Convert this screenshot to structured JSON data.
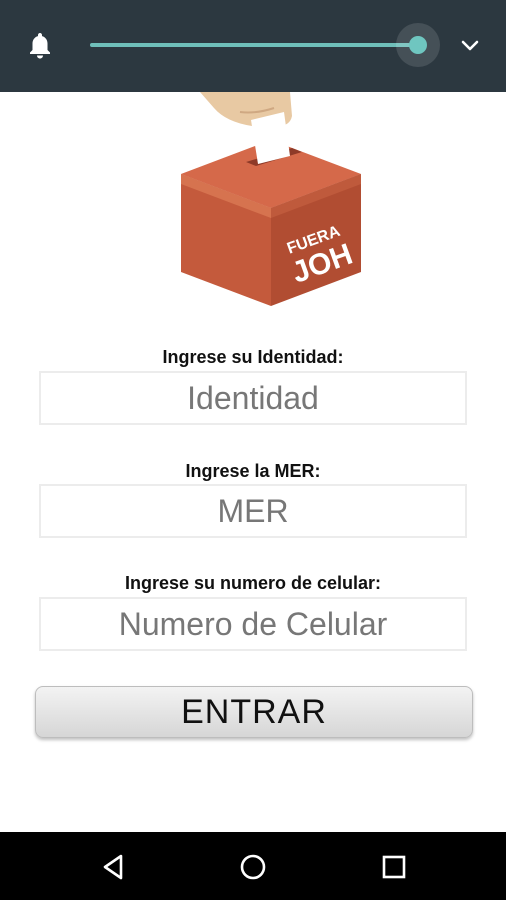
{
  "volume_panel": {
    "icon": "bell-icon",
    "level": 1.0,
    "expand_icon": "chevron-down-icon",
    "accent_color": "#6fc6c0"
  },
  "logo": {
    "box_text_line1": "FUERA",
    "box_text_line2": "JOH"
  },
  "form": {
    "identity_label": "Ingrese su Identidad:",
    "identity_placeholder": "Identidad",
    "mer_label": "Ingrese la MER:",
    "mer_placeholder": "MER",
    "phone_label": "Ingrese su numero de celular:",
    "phone_placeholder": "Numero de Celular",
    "submit_label": "ENTRAR"
  },
  "navbar": {
    "back_icon": "back-triangle-icon",
    "home_icon": "home-circle-icon",
    "recents_icon": "recents-square-icon"
  }
}
